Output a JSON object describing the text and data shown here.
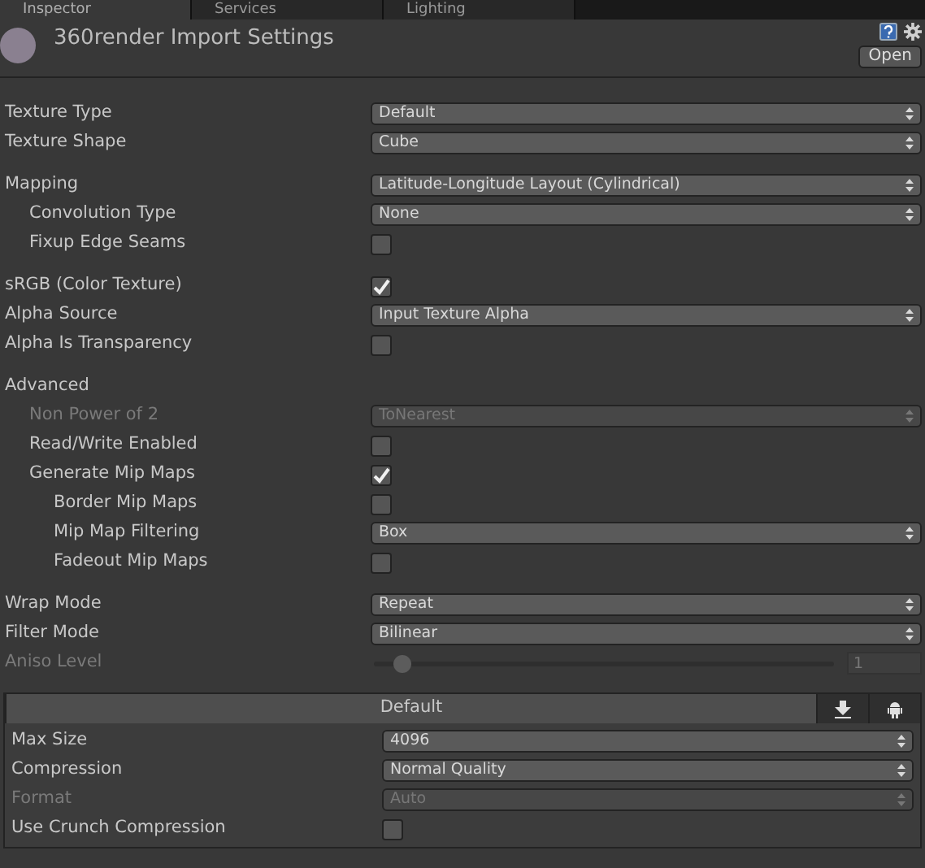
{
  "tabs": [
    {
      "label": "Inspector",
      "selected": true
    },
    {
      "label": "Services",
      "selected": false
    },
    {
      "label": "Lighting",
      "selected": false
    }
  ],
  "header": {
    "title": "360render Import Settings",
    "open_button": "Open"
  },
  "groups": [
    [
      {
        "kind": "dropdown",
        "label": "Texture Type",
        "value": "Default",
        "disabled": false
      },
      {
        "kind": "dropdown",
        "label": "Texture Shape",
        "value": "Cube",
        "disabled": false
      }
    ],
    [
      {
        "kind": "dropdown",
        "label": "Mapping",
        "value": "Latitude-Longitude Layout (Cylindrical)",
        "disabled": false,
        "children": [
          {
            "kind": "dropdown",
            "label": "Convolution Type",
            "value": "None",
            "disabled": false
          },
          {
            "kind": "checkbox",
            "label": "Fixup Edge Seams",
            "checked": false,
            "disabled": false
          }
        ]
      }
    ],
    [
      {
        "kind": "checkbox",
        "label": "sRGB (Color Texture)",
        "checked": true,
        "disabled": false
      },
      {
        "kind": "dropdown",
        "label": "Alpha Source",
        "value": "Input Texture Alpha",
        "disabled": false
      },
      {
        "kind": "checkbox",
        "label": "Alpha Is Transparency",
        "checked": false,
        "disabled": false
      }
    ],
    [
      {
        "kind": "heading",
        "label": "Advanced",
        "children": [
          {
            "kind": "dropdown",
            "label": "Non Power of 2",
            "value": "ToNearest",
            "disabled": true
          },
          {
            "kind": "checkbox",
            "label": "Read/Write Enabled",
            "checked": false,
            "disabled": false
          },
          {
            "kind": "checkbox",
            "label": "Generate Mip Maps",
            "checked": true,
            "disabled": false,
            "children": [
              {
                "kind": "checkbox",
                "label": "Border Mip Maps",
                "checked": false,
                "disabled": false
              },
              {
                "kind": "dropdown",
                "label": "Mip Map Filtering",
                "value": "Box",
                "disabled": false
              },
              {
                "kind": "checkbox",
                "label": "Fadeout Mip Maps",
                "checked": false,
                "disabled": false
              }
            ]
          }
        ]
      }
    ],
    [
      {
        "kind": "dropdown",
        "label": "Wrap Mode",
        "value": "Repeat",
        "disabled": false
      },
      {
        "kind": "dropdown",
        "label": "Filter Mode",
        "value": "Bilinear",
        "disabled": false
      },
      {
        "kind": "slider",
        "label": "Aniso Level",
        "level": 0,
        "value": "1",
        "disabled": true
      }
    ]
  ],
  "platform": {
    "tabs": [
      {
        "label": "Default",
        "selected": true
      },
      {
        "selected": false
      },
      {
        "selected": false
      }
    ],
    "rows": [
      {
        "kind": "dropdown",
        "label": "Max Size",
        "value": "4096",
        "disabled": false
      },
      {
        "kind": "dropdown",
        "label": "Compression",
        "value": "Normal Quality",
        "disabled": false
      },
      {
        "kind": "dropdown",
        "label": "Format",
        "value": "Auto",
        "disabled": true
      },
      {
        "kind": "checkbox",
        "label": "Use Crunch Compression",
        "checked": false,
        "disabled": false
      }
    ]
  }
}
